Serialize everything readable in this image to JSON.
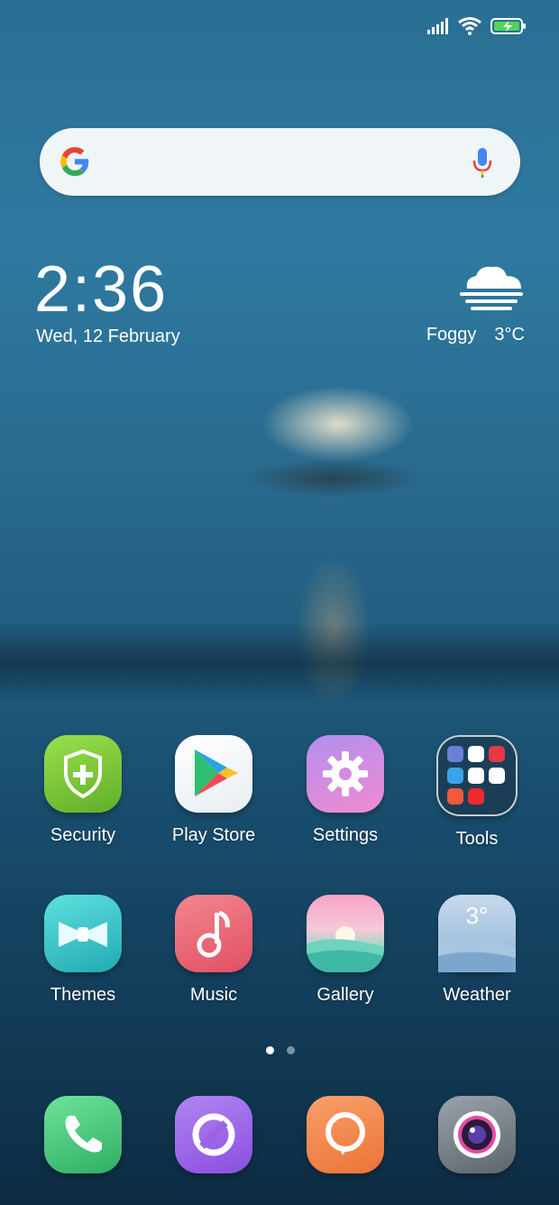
{
  "clock": {
    "time": "2:36",
    "date": "Wed, 12 February"
  },
  "weather": {
    "condition": "Foggy",
    "temperature": "3°C",
    "icon": "fog-cloud-icon"
  },
  "search": {
    "logo": "google-g-icon",
    "mic_icon": "microphone-icon"
  },
  "status_bar": {
    "signal": "signal-bars-icon",
    "wifi": "wifi-icon",
    "battery": "battery-charging-icon"
  },
  "apps": [
    {
      "label": "Security",
      "icon": "shield-plus-icon"
    },
    {
      "label": "Play Store",
      "icon": "play-triangle-icon"
    },
    {
      "label": "Settings",
      "icon": "gear-icon"
    },
    {
      "label": "Tools",
      "icon": "folder-icon"
    },
    {
      "label": "Themes",
      "icon": "bow-tie-icon"
    },
    {
      "label": "Music",
      "icon": "music-note-icon"
    },
    {
      "label": "Gallery",
      "icon": "landscape-icon"
    },
    {
      "label": "Weather",
      "icon": "weather-3-icon",
      "badge": "3°"
    }
  ],
  "dock": [
    {
      "name": "phone",
      "icon": "phone-handset-icon"
    },
    {
      "name": "browser",
      "icon": "browser-swirl-icon"
    },
    {
      "name": "messages",
      "icon": "chat-bubble-icon"
    },
    {
      "name": "camera",
      "icon": "camera-lens-icon"
    }
  ],
  "pager": {
    "pages": 2,
    "current": 1
  },
  "colors": {
    "security": "#7cc63a",
    "settings": "#c98be0",
    "themes": "#38c6c8",
    "music": "#ee6a7b",
    "phone": "#3fbf74",
    "browser": "#9b5fe0",
    "messages": "#f08a4b"
  }
}
